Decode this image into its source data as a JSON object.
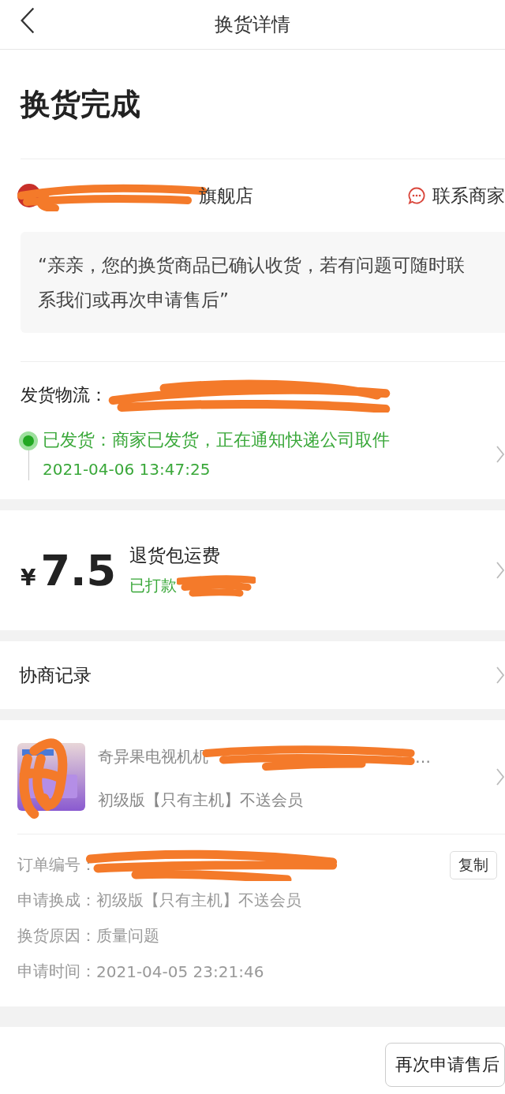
{
  "nav": {
    "title": "换货详情"
  },
  "status": {
    "title": "换货完成"
  },
  "store": {
    "name": "旗舰店",
    "redacted": true,
    "contact": "联系商家"
  },
  "message": "“亲亲，您的换货商品已确认收货，若有问题可随时联系我们或再次申请售后”",
  "logistics": {
    "label": "发货物流：",
    "redacted": true,
    "status": "已发货：商家已发货，正在通知快递公司取件",
    "time": "2021-04-06 13:47:25"
  },
  "refund": {
    "currency": "¥",
    "amount": "7.5",
    "title": "退货包运费",
    "status": "已打款",
    "redacted": true
  },
  "negotiation": {
    "label": "协商记录"
  },
  "product": {
    "image": {
      "kind": "picture",
      "redacted": true
    },
    "title": "奇异果电视机机",
    "redacted": true,
    "ellipsis": "…",
    "spec": "初级版【只有主机】不送会员"
  },
  "order_info": [
    {
      "label": "订单编号：",
      "redacted": true,
      "action": "复制"
    },
    {
      "label": "申请换成：",
      "value": "初级版【只有主机】不送会员"
    },
    {
      "label": "换货原因：",
      "value": "质量问题"
    },
    {
      "label": "申请时间：",
      "value": "2021-04-05 23:21:46"
    }
  ],
  "footer": {
    "button": "再次申请售后"
  }
}
